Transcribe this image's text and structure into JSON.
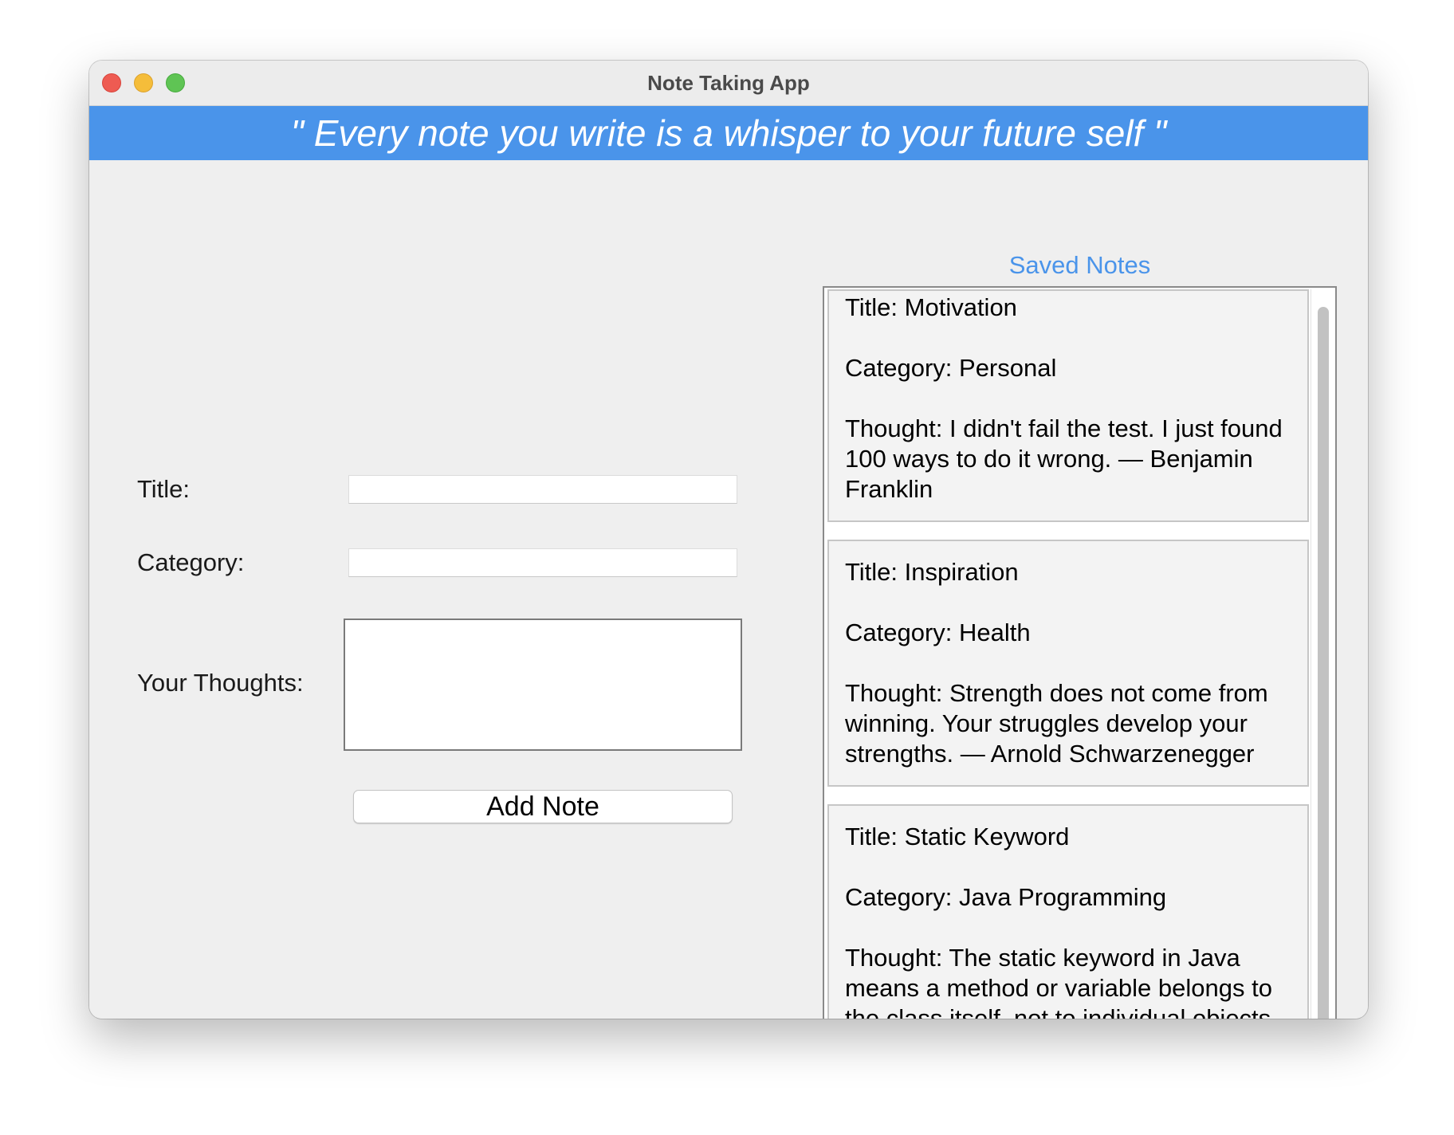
{
  "window": {
    "title": "Note Taking App"
  },
  "banner": {
    "quote": "\" Every note you write is a whisper to your future self \""
  },
  "form": {
    "title_label": "Title:",
    "title_value": "",
    "category_label": "Category:",
    "category_value": "",
    "thoughts_label": "Your Thoughts:",
    "thoughts_value": "",
    "add_button_label": "Add Note"
  },
  "saved_notes": {
    "heading": "Saved Notes",
    "notes": [
      {
        "title": "Title: Motivation",
        "category": "Category: Personal",
        "thought": "Thought: I didn't fail the test. I just found 100 ways to do it wrong. — Benjamin Franklin"
      },
      {
        "title": "Title: Inspiration",
        "category": "Category: Health",
        "thought": "Thought: Strength does not come from winning. Your struggles develop your strengths. — Arnold Schwarzenegger"
      },
      {
        "title": "Title: Static Keyword",
        "category": "Category: Java Programming",
        "thought": "Thought: The static keyword in Java means a method or variable belongs to the class itself, not to individual objects."
      }
    ]
  },
  "colors": {
    "accent": "#4a94ea",
    "window_bg": "#efefef",
    "card_bg": "#f3f3f3"
  }
}
